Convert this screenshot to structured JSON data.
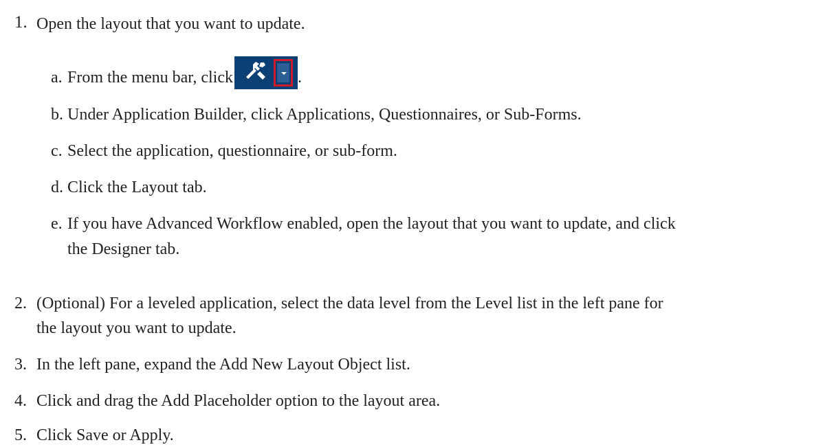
{
  "steps": [
    {
      "num": "1.",
      "text": "Open the layout that you want to update."
    },
    {
      "num": "2.",
      "line1": "(Optional) For a leveled application, select the data level from the Level list in the left pane for",
      "line2": "the layout you want to update."
    },
    {
      "num": "3.",
      "text": "In the left pane, expand the Add New Layout Object list."
    },
    {
      "num": "4.",
      "text": "Click and drag the Add Placeholder option to the layout area."
    },
    {
      "num": "5.",
      "text": "Click Save or Apply."
    }
  ],
  "substeps": [
    {
      "letter": "a.",
      "text": "From the menu bar, click",
      "suffix": "."
    },
    {
      "letter": "b.",
      "text": "Under Application Builder, click Applications, Questionnaires, or Sub-Forms."
    },
    {
      "letter": "c.",
      "text": "Select the application, questionnaire, or sub-form."
    },
    {
      "letter": "d.",
      "text": "Click the Layout tab."
    },
    {
      "letter": "e.",
      "line1": "If you have Advanced Workflow enabled, open the layout that you want to update, and click",
      "line2": "the Designer tab."
    }
  ],
  "icons": {
    "tools": "tools-icon",
    "dropdown": "dropdown-arrow-icon"
  },
  "colors": {
    "toolbar_bg": "#0c3f73",
    "highlight_border": "#d11a2a"
  }
}
